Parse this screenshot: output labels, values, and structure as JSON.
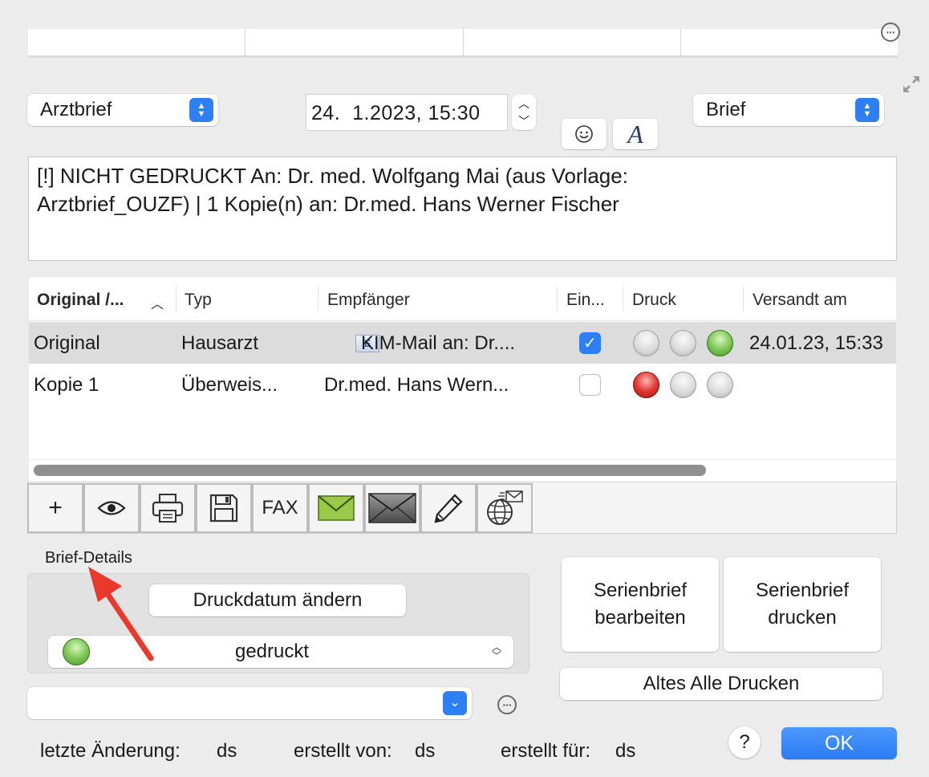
{
  "header": {
    "doc_type_select": "Arztbrief",
    "date_value": "24.  1.2023, 15:30",
    "format_select": "Brief"
  },
  "notes": {
    "line1": "[!] NICHT GEDRUCKT An:  Dr. med. Wolfgang Mai (aus Vorlage:",
    "line2": "Arztbrief_OUZF) | 1 Kopie(n) an: Dr.med. Hans Werner Fischer"
  },
  "table": {
    "columns": [
      "Original /...",
      "Typ",
      "Empfänger",
      "Ein...",
      "Druck",
      "Versandt am"
    ],
    "rows": [
      {
        "original": "Original",
        "typ": "Hausarzt",
        "empfaenger": "KIM-Mail an: Dr....",
        "checked": true,
        "druck": [
          "gray",
          "gray",
          "green"
        ],
        "versandt": "24.01.23, 15:33"
      },
      {
        "original": "Kopie 1",
        "typ": "Überweis...",
        "empfaenger": "Dr.med. Hans Wern...",
        "checked": false,
        "druck": [
          "red",
          "gray",
          "gray"
        ],
        "versandt": ""
      }
    ]
  },
  "toolbar": {
    "add": "+",
    "fax": "FAX"
  },
  "details": {
    "label": "Brief-Details",
    "change_date_button": "Druckdatum ändern",
    "status_select": "gedruckt"
  },
  "actions": {
    "serienbrief_bearbeiten": [
      "Serienbrief",
      "bearbeiten"
    ],
    "serienbrief_drucken": [
      "Serienbrief",
      "drucken"
    ],
    "altes_alle_drucken": "Altes Alle Drucken"
  },
  "footer": {
    "last_change_label": "letzte Änderung:",
    "last_change_value": "ds",
    "created_by_label": "erstellt von:",
    "created_by_value": "ds",
    "created_for_label": "erstellt für:",
    "created_for_value": "ds",
    "help": "?",
    "ok": "OK"
  },
  "colors": {
    "accent_blue": "#2f7ff4",
    "led_green": "#7cc653",
    "led_red": "#e0352d",
    "arrow_red": "#e8392b"
  },
  "icons": [
    "more-icon",
    "expand-icon",
    "smiley-icon",
    "font-icon",
    "eye-icon",
    "printer-icon",
    "floppy-disk-icon",
    "envelope-green-icon",
    "envelope-gray-icon",
    "pencil-icon",
    "globe-mail-icon",
    "checkmark-icon",
    "chevron-down-icon",
    "sort-ascending-icon",
    "annotation-arrow"
  ]
}
